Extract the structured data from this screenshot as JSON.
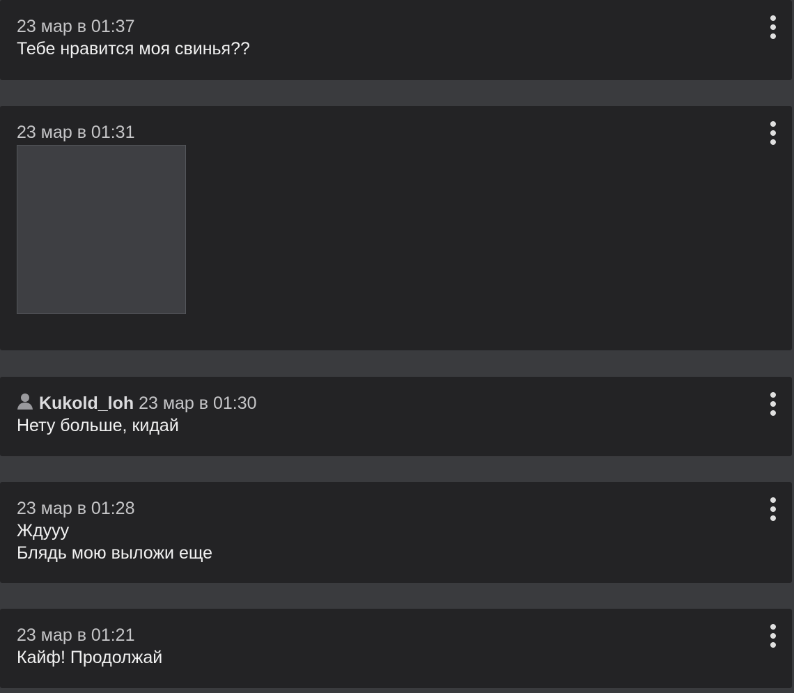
{
  "messages": [
    {
      "timestamp": "23 мар в 01:37",
      "text": "Тебе нравится моя свинья??"
    },
    {
      "timestamp": "23 мар в 01:31",
      "attachment": "photo (explicit image omitted)"
    },
    {
      "author": "Kukold_loh",
      "timestamp": "23 мар в 01:30",
      "text": "Нету больше, кидай"
    },
    {
      "timestamp": "23 мар в 01:28",
      "text": "Ждууу\nБлядь мою выложи еще"
    },
    {
      "timestamp": "23 мар в 01:21",
      "text": "Кайф! Продолжай"
    }
  ],
  "icons": {
    "menu": "more-vertical-icon",
    "user": "user-icon"
  },
  "colors": {
    "page_background": "#3a3b3e",
    "card_background": "#232325",
    "timestamp_text": "#c6c6c8",
    "body_text": "#f1f1f1"
  }
}
